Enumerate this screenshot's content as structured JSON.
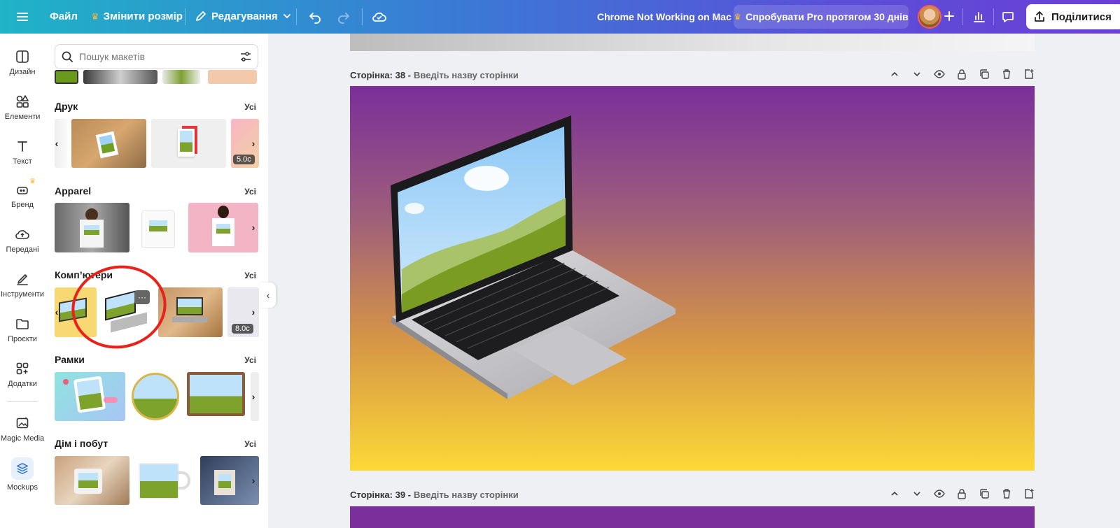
{
  "topbar": {
    "file": "Файл",
    "resize": "Змінити розмір",
    "editing": "Редагування",
    "doc_title": "Chrome Not Working on Mac",
    "pro": "Спробувати Pro протягом 30 днів",
    "share": "Поділитися"
  },
  "rail": {
    "items": [
      {
        "label": "Дизайн",
        "icon": "layout-icon"
      },
      {
        "label": "Елементи",
        "icon": "shapes-icon"
      },
      {
        "label": "Текст",
        "icon": "text-icon"
      },
      {
        "label": "Бренд",
        "icon": "brand-icon"
      },
      {
        "label": "Передані",
        "icon": "upload-cloud-icon"
      },
      {
        "label": "Інструменти",
        "icon": "pen-tool-icon"
      },
      {
        "label": "Проєкти",
        "icon": "folder-icon"
      },
      {
        "label": "Додатки",
        "icon": "apps-icon"
      },
      {
        "label": "Magic Media",
        "icon": "magic-media-icon"
      },
      {
        "label": "Mockups",
        "icon": "mockups-icon"
      }
    ]
  },
  "panel": {
    "search_placeholder": "Пошук макетів",
    "see_all": "Усі",
    "sections": [
      {
        "title": "Друк",
        "badge": "5.0с"
      },
      {
        "title": "Apparel"
      },
      {
        "title": "Комп’ютери",
        "badge": "8.0с",
        "more": "···"
      },
      {
        "title": "Рамки"
      },
      {
        "title": "Дім і побут"
      }
    ]
  },
  "pages": [
    {
      "label": "Сторінка: 38 -",
      "placeholder": "Введіть назву сторінки"
    },
    {
      "label": "Сторінка: 39 -",
      "placeholder": "Введіть назву сторінки"
    }
  ],
  "colors": {
    "accent_ring": "#e8221b",
    "crown": "#f6b73c",
    "page_gradient_top": "#7a2f9a",
    "page_gradient_bottom": "#fbd936"
  }
}
